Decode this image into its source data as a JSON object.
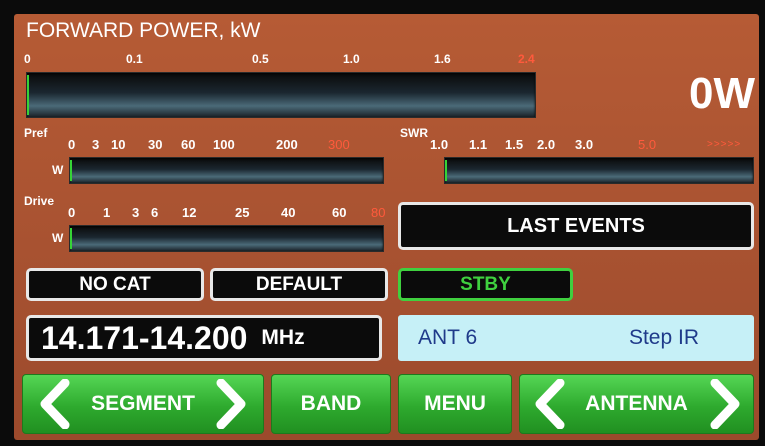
{
  "forward_power": {
    "title": "FORWARD POWER, kW",
    "scale": [
      {
        "label": "0",
        "alert": false
      },
      {
        "label": "0.1",
        "alert": false
      },
      {
        "label": "0.5",
        "alert": false
      },
      {
        "label": "1.0",
        "alert": false
      },
      {
        "label": "1.6",
        "alert": false
      },
      {
        "label": "2.4",
        "alert": true
      }
    ],
    "reading": "0W",
    "level": 0
  },
  "pref": {
    "label": "Pref",
    "unit": "W",
    "scale": [
      {
        "label": "0",
        "alert": false
      },
      {
        "label": "3",
        "alert": false
      },
      {
        "label": "10",
        "alert": false
      },
      {
        "label": "30",
        "alert": false
      },
      {
        "label": "60",
        "alert": false
      },
      {
        "label": "100",
        "alert": false
      },
      {
        "label": "200",
        "alert": false
      },
      {
        "label": "300",
        "alert": true
      }
    ],
    "level": 0
  },
  "swr": {
    "label": "SWR",
    "scale": [
      {
        "label": "1.0",
        "alert": false
      },
      {
        "label": "1.1",
        "alert": false
      },
      {
        "label": "1.5",
        "alert": false
      },
      {
        "label": "2.0",
        "alert": false
      },
      {
        "label": "3.0",
        "alert": false
      },
      {
        "label": "5.0",
        "alert": true
      },
      {
        "label": ">>>>>",
        "alert": true
      }
    ],
    "level": 0
  },
  "drive": {
    "label": "Drive",
    "unit": "W",
    "scale": [
      {
        "label": "0",
        "alert": false
      },
      {
        "label": "1",
        "alert": false
      },
      {
        "label": "3",
        "alert": false
      },
      {
        "label": "6",
        "alert": false
      },
      {
        "label": "12",
        "alert": false
      },
      {
        "label": "25",
        "alert": false
      },
      {
        "label": "40",
        "alert": false
      },
      {
        "label": "60",
        "alert": false
      },
      {
        "label": "80",
        "alert": true
      }
    ],
    "level": 0
  },
  "status": {
    "cat": "NO CAT",
    "profile": "DEFAULT",
    "mode": "STBY",
    "last_events": "LAST EVENTS"
  },
  "frequency": {
    "range": "14.171-14.200",
    "unit": "MHz"
  },
  "antenna_info": {
    "antenna": "ANT 6",
    "mode": "Step IR"
  },
  "buttons": {
    "segment": "SEGMENT",
    "band": "BAND",
    "menu": "MENU",
    "antenna": "ANTENNA"
  },
  "colors": {
    "background": "#a85231",
    "alert": "#ff5a3c",
    "indicator": "#36d336",
    "button": "#2eaa2e",
    "info_panel": "#c6f0f7"
  },
  "icons": {
    "left": "chevron-left-icon",
    "right": "chevron-right-icon"
  }
}
